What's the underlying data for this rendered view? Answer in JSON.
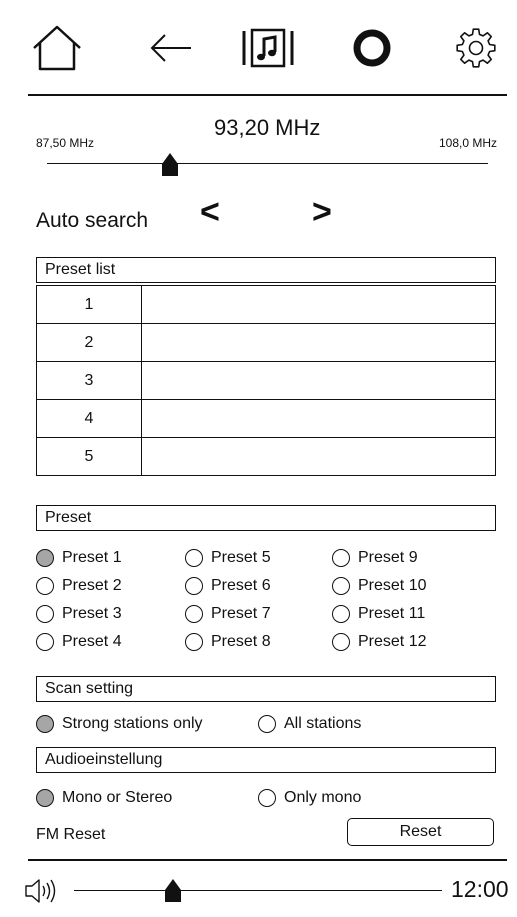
{
  "toolbar": {
    "home_icon": "home-icon",
    "back_icon": "back-arrow-icon",
    "music_icon": "music-library-icon",
    "assistant_icon": "ring-icon",
    "settings_icon": "gear-icon"
  },
  "tuner": {
    "min_label": "87,50 MHz",
    "max_label": "108,0 MHz",
    "current_label": "93,20 MHz",
    "current_mhz": 93.2,
    "range_mhz": [
      87.5,
      108.0
    ]
  },
  "auto_search": {
    "label": "Auto search",
    "prev": "<",
    "next": ">"
  },
  "preset_list": {
    "title": "Preset list",
    "rows": [
      {
        "num": "1",
        "name": ""
      },
      {
        "num": "2",
        "name": ""
      },
      {
        "num": "3",
        "name": ""
      },
      {
        "num": "4",
        "name": ""
      },
      {
        "num": "5",
        "name": ""
      }
    ]
  },
  "preset": {
    "title": "Preset",
    "options": [
      [
        "Preset 1",
        "Preset 5",
        "Preset 9"
      ],
      [
        "Preset 2",
        "Preset 6",
        "Preset 10"
      ],
      [
        "Preset 3",
        "Preset 7",
        "Preset 11"
      ],
      [
        "Preset 4",
        "Preset 8",
        "Preset 12"
      ]
    ],
    "selected": "Preset 1"
  },
  "scan_setting": {
    "title": "Scan setting",
    "option_strong": "Strong stations only",
    "option_all": "All stations",
    "selected": "Strong stations only"
  },
  "audio_setting": {
    "title": "Audioeinstellung",
    "option_stereo": "Mono or Stereo",
    "option_mono": "Only mono",
    "selected": "Mono or Stereo"
  },
  "fm_reset": {
    "label": "FM Reset",
    "button": "Reset"
  },
  "status_bar": {
    "volume_icon": "speaker-icon",
    "volume_level": 0.27,
    "time": "12:00"
  }
}
